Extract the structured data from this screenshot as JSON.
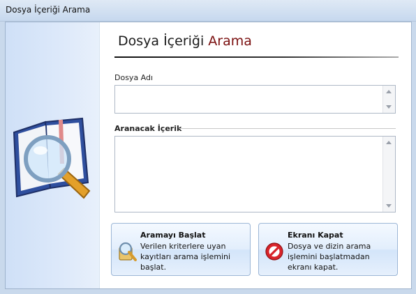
{
  "window": {
    "title": "Dosya İçeriği Arama"
  },
  "header": {
    "title_main": "Dosya İçeriği ",
    "title_accent": "Arama"
  },
  "form": {
    "filename_label": "Dosya Adı",
    "filename_value": "",
    "content_label": "Aranacak İçerik",
    "content_value": ""
  },
  "buttons": {
    "start": {
      "title": "Aramayı Başlat",
      "description": "Verilen kriterlere uyan kayıtları arama işlemini başlat.",
      "icon": "magnifier-folder-icon"
    },
    "close": {
      "title": "Ekranı Kapat",
      "description": "Dosya ve dizin arama işlemini başlatmadan ekranı kapat.",
      "icon": "no-entry-icon"
    }
  },
  "colors": {
    "accent": "#7a0f0f",
    "panel": "#d6e5f8"
  }
}
